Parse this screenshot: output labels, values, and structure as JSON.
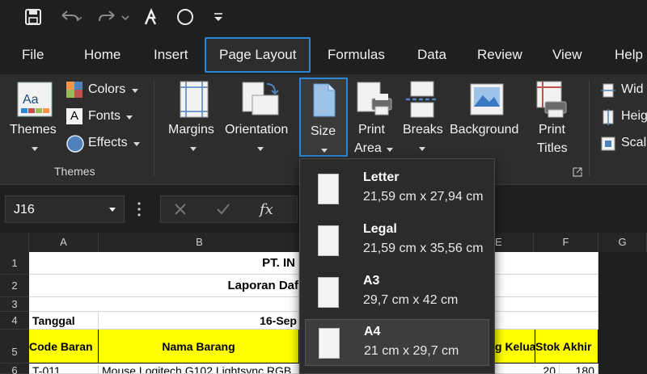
{
  "quick_access": {
    "icons": [
      "save-icon",
      "undo-icon",
      "redo-icon",
      "draw-icon",
      "shape-icon",
      "customize-icon"
    ]
  },
  "tabs": [
    "File",
    "Home",
    "Insert",
    "Page Layout",
    "Formulas",
    "Data",
    "Review",
    "View",
    "Help"
  ],
  "active_tab": "Page Layout",
  "ribbon": {
    "themes": {
      "themes_label": "Themes",
      "colors_label": "Colors",
      "fonts_label": "Fonts",
      "effects_label": "Effects",
      "group_label": "Themes"
    },
    "page_setup": {
      "margins_label": "Margins",
      "orientation_label": "Orientation",
      "size_label": "Size",
      "print_area_label_1": "Print",
      "print_area_label_2": "Area",
      "breaks_label": "Breaks",
      "background_label": "Background",
      "print_titles_label_1": "Print",
      "print_titles_label_2": "Titles"
    },
    "scale": {
      "width_label": "Wid",
      "height_label": "Heig",
      "scale_label": "Scal"
    }
  },
  "formula_bar": {
    "name_box": "J16",
    "fx": "fx"
  },
  "columns": [
    "A",
    "B",
    "E",
    "F",
    "G"
  ],
  "rows": [
    "1",
    "2",
    "3",
    "4",
    "5",
    "6"
  ],
  "sheet": {
    "b1": "PT. IN",
    "b2": "Laporan Daf",
    "a4": "Tanggal",
    "b4": "16-Sep",
    "a5": "Code Baran",
    "b5": "Nama Barang",
    "e5": "g Kelua",
    "f5": "Stok Akhir",
    "a6": "T-011",
    "b6": "Mouse Logitech G102 Lightsync RGB",
    "e6": "20",
    "f6": "180"
  },
  "size_menu": [
    {
      "name": "Letter",
      "dims": "21,59 cm x 27,94 cm"
    },
    {
      "name": "Legal",
      "dims": "21,59 cm x 35,56 cm"
    },
    {
      "name": "A3",
      "dims": "29,7 cm x 42 cm"
    },
    {
      "name": "A4",
      "dims": "21 cm x 29,7 cm"
    }
  ],
  "selected_size": "A4",
  "colors": {
    "accent": "#2b88d8",
    "header_fill": "#ffff00"
  }
}
